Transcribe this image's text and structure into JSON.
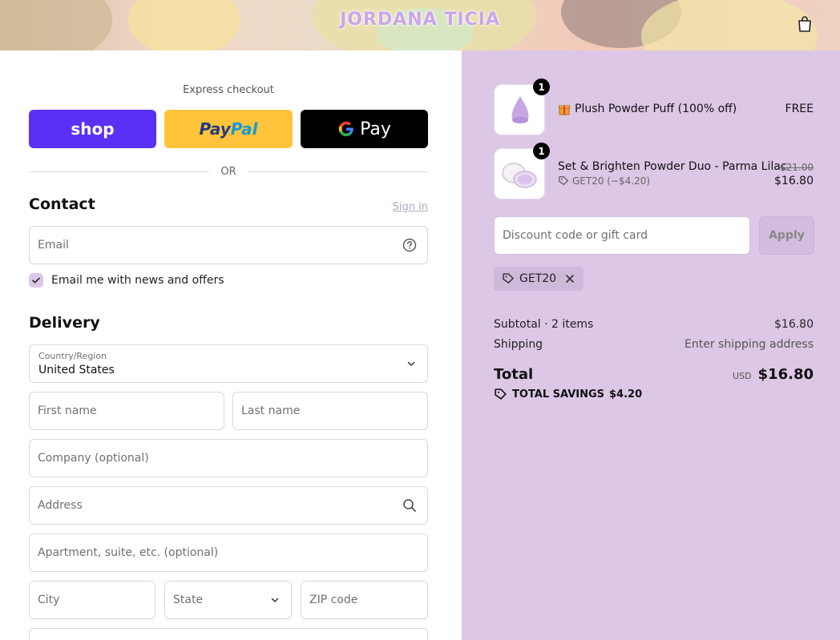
{
  "header": {
    "brand": "JORDANA TICIA",
    "cart_icon": "shopping-bag-icon"
  },
  "express": {
    "title": "Express checkout",
    "shop_label": "shop",
    "paypal_label_1": "Pay",
    "paypal_label_2": "Pal",
    "gpay_label": "Pay",
    "or_label": "OR"
  },
  "contact": {
    "title": "Contact",
    "signin_label": "Sign in",
    "email_placeholder": "Email",
    "newsletter_label": "Email me with news and offers",
    "newsletter_checked": true
  },
  "delivery": {
    "title": "Delivery",
    "country_label": "Country/Region",
    "country_value": "United States",
    "first_name_placeholder": "First name",
    "last_name_placeholder": "Last name",
    "company_placeholder": "Company (optional)",
    "address_placeholder": "Address",
    "apartment_placeholder": "Apartment, suite, etc. (optional)",
    "city_placeholder": "City",
    "state_placeholder": "State",
    "zip_placeholder": "ZIP code"
  },
  "order": {
    "items": [
      {
        "name": "Plush Powder Puff (100% off)",
        "price": "FREE",
        "quantity": "1",
        "icon": "gift-icon"
      },
      {
        "name": "Set & Brighten Powder Duo - Parma Lilac",
        "old_price": "$21.00",
        "price": "$16.80",
        "quantity": "1",
        "discount": "GET20 (−$4.20)"
      }
    ],
    "discount_placeholder": "Discount code or gift card",
    "apply_label": "Apply",
    "applied_code": "GET20",
    "subtotal_label": "Subtotal · 2 items",
    "subtotal_value": "$16.80",
    "shipping_label": "Shipping",
    "shipping_value": "Enter shipping address",
    "total_label": "Total",
    "currency": "USD",
    "total_value": "$16.80",
    "savings_label": "TOTAL SAVINGS",
    "savings_value": "$4.20"
  },
  "colors": {
    "accent_lilac": "#dcc7e6",
    "shop_pay": "#5a31f4",
    "paypal": "#ffc439",
    "gpay": "#000000"
  }
}
